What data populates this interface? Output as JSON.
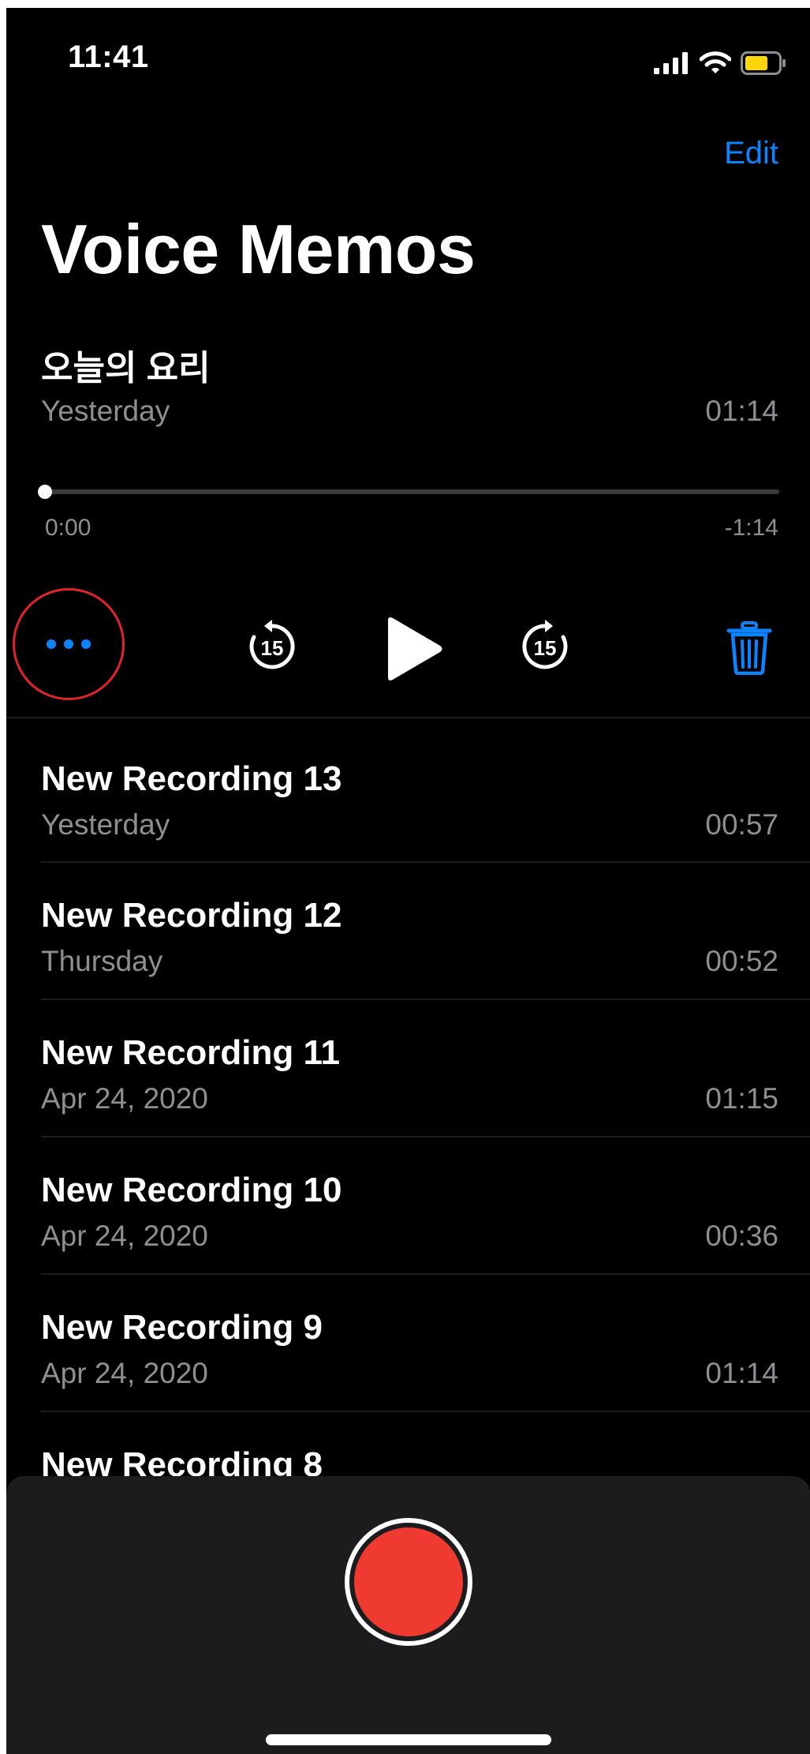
{
  "status_bar": {
    "time": "11:41",
    "icons": [
      "cellular-signal-icon",
      "wifi-icon",
      "battery-icon"
    ]
  },
  "nav": {
    "edit_label": "Edit"
  },
  "page_title": "Voice Memos",
  "expanded_recording": {
    "title": "오늘의 요리",
    "date": "Yesterday",
    "duration": "01:14",
    "elapsed": "0:00",
    "remaining": "-1:14",
    "progress_fraction": 0
  },
  "controls": {
    "more_icon": "more-icon",
    "skip_back_icon": "skip-back-15-icon",
    "skip_back_seconds": "15",
    "play_icon": "play-icon",
    "skip_forward_icon": "skip-forward-15-icon",
    "skip_forward_seconds": "15",
    "trash_icon": "trash-icon"
  },
  "recordings": [
    {
      "title": "New Recording 13",
      "date": "Yesterday",
      "duration": "00:57"
    },
    {
      "title": "New Recording 12",
      "date": "Thursday",
      "duration": "00:52"
    },
    {
      "title": "New Recording 11",
      "date": "Apr 24, 2020",
      "duration": "01:15"
    },
    {
      "title": "New Recording 10",
      "date": "Apr 24, 2020",
      "duration": "00:36"
    },
    {
      "title": "New Recording 9",
      "date": "Apr 24, 2020",
      "duration": "01:14"
    },
    {
      "title": "New Recording 8",
      "date": "",
      "duration": ""
    }
  ],
  "colors": {
    "accent": "#0a84ff",
    "record": "#ee3a31",
    "highlight_circle": "#e2232a",
    "secondary_text": "#8e8e93",
    "background": "#000000",
    "panel": "#1c1c1e"
  }
}
